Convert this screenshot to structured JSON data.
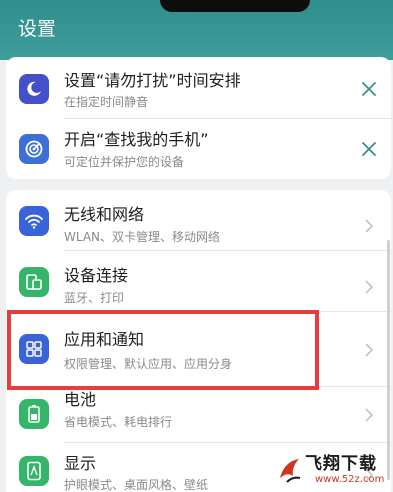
{
  "header": {
    "title": "设置"
  },
  "suggestions": [
    {
      "label": "设置“请勿打扰”时间安排",
      "sub": "在指定时间静音",
      "icon": "moon-icon",
      "icon_color": "#4450c7",
      "action": "dismiss"
    },
    {
      "label": "开启“查找我的手机”",
      "sub": "可定位并保护您的设备",
      "icon": "locate-icon",
      "icon_color": "#3d6fd6",
      "action": "dismiss"
    }
  ],
  "settings": [
    {
      "label": "无线和网络",
      "sub": "WLAN、双卡管理、移动网络",
      "icon": "wifi-icon",
      "icon_color": "#3b63d9"
    },
    {
      "label": "设备连接",
      "sub": "蓝牙、打印",
      "icon": "device-connect-icon",
      "icon_color": "#35b56a"
    },
    {
      "label": "应用和通知",
      "sub": "权限管理、默认应用、应用分身",
      "icon": "apps-icon",
      "icon_color": "#3b63d9"
    },
    {
      "label": "电池",
      "sub": "省电模式、耗电排行",
      "icon": "battery-icon",
      "icon_color": "#35b56a"
    },
    {
      "label": "显示",
      "sub": "护眼模式、桌面风格、壁纸",
      "icon": "display-icon",
      "icon_color": "#35b56a"
    }
  ],
  "colors": {
    "header": "#3a9896",
    "highlight": "#ea3c3c"
  },
  "watermark": {
    "text": "飞翔下载",
    "url": "www.52z.com"
  }
}
